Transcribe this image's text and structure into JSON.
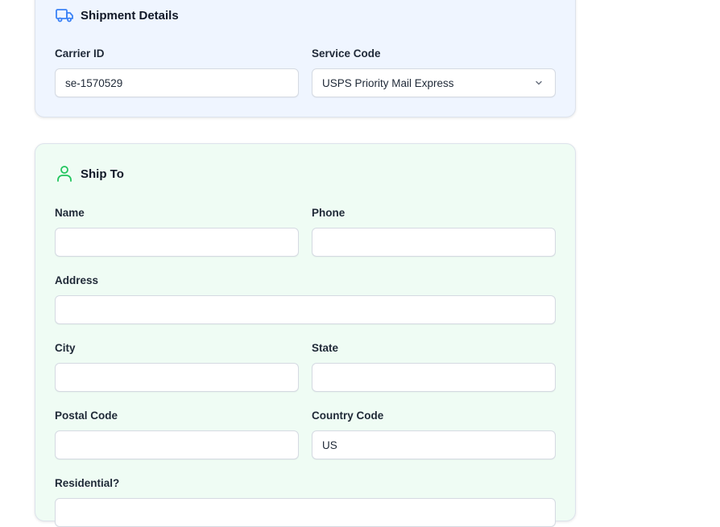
{
  "shipment": {
    "title": "Shipment Details",
    "carrier_id_label": "Carrier ID",
    "carrier_id_value": "se-1570529",
    "service_code_label": "Service Code",
    "service_code_value": "USPS Priority Mail Express",
    "accent_color": "#3b82f6"
  },
  "ship_to": {
    "title": "Ship To",
    "accent_color": "#22c55e",
    "name_label": "Name",
    "name_value": "",
    "phone_label": "Phone",
    "phone_value": "",
    "address_label": "Address",
    "address_value": "",
    "city_label": "City",
    "city_value": "",
    "state_label": "State",
    "state_value": "",
    "postal_code_label": "Postal Code",
    "postal_code_value": "",
    "country_code_label": "Country Code",
    "country_code_value": "US",
    "residential_label": "Residential?"
  },
  "icons": {
    "shipment": "truck-icon",
    "ship_to": "user-icon",
    "select": "chevron-down-icon"
  }
}
